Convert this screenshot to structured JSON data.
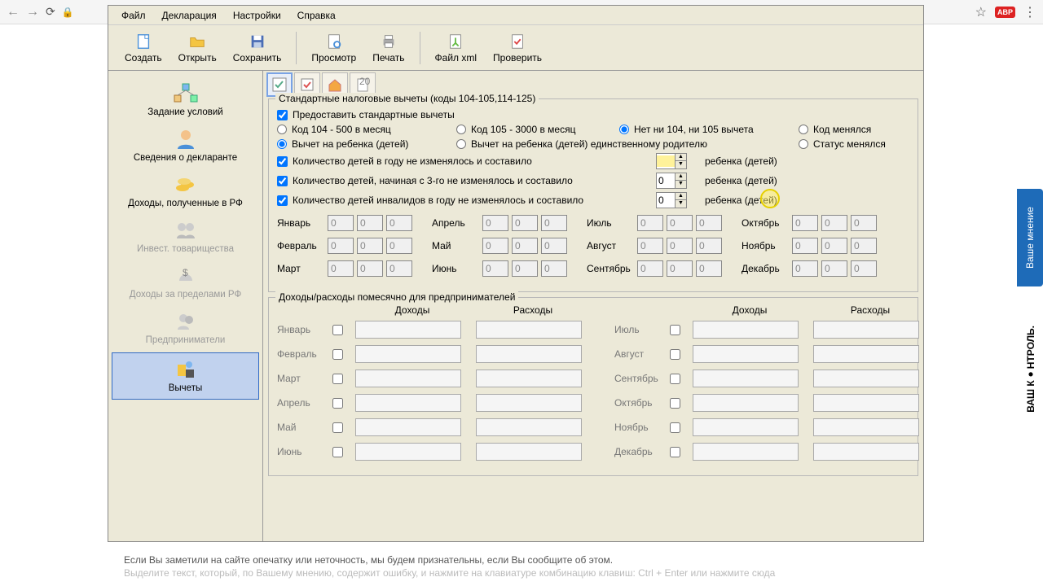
{
  "menu": [
    "Файл",
    "Декларация",
    "Настройки",
    "Справка"
  ],
  "toolbar": [
    "Создать",
    "Открыть",
    "Сохранить",
    "Просмотр",
    "Печать",
    "Файл xml",
    "Проверить"
  ],
  "sidebar": [
    {
      "label": "Задание условий",
      "disabled": false
    },
    {
      "label": "Сведения о декларанте",
      "disabled": false
    },
    {
      "label": "Доходы, полученные в РФ",
      "disabled": false
    },
    {
      "label": "Инвест. товарищества",
      "disabled": true
    },
    {
      "label": "Доходы за пределами РФ",
      "disabled": true
    },
    {
      "label": "Предприниматели",
      "disabled": true
    },
    {
      "label": "Вычеты",
      "disabled": false,
      "selected": true
    }
  ],
  "group1": {
    "title": "Стандартные налоговые вычеты (коды 104-105,114-125)",
    "provide": "Предоставить стандартные вычеты",
    "radios1": [
      "Код 104 - 500 в месяц",
      "Код 105 - 3000 в месяц",
      "Нет ни 104, ни 105 вычета",
      "Код менялся"
    ],
    "radios1_sel": 2,
    "radios2": [
      "Вычет на ребенка (детей)",
      "Вычет на ребенка (детей) единственному родителю",
      "Статус менялся"
    ],
    "radios2_sel": 0,
    "children_lines": [
      "Количество детей в году не изменялось и составило",
      "Количество детей, начиная с 3-го не изменялось и составило",
      "Количество детей инвалидов в году не изменялось и составило"
    ],
    "children_suffix": "ребенка (детей)",
    "children_values": [
      "",
      "0",
      "0"
    ],
    "months": [
      "Январь",
      "Февраль",
      "Март",
      "Апрель",
      "Май",
      "Июнь",
      "Июль",
      "Август",
      "Сентябрь",
      "Октябрь",
      "Ноябрь",
      "Декабрь"
    ],
    "month_val": "0"
  },
  "group2": {
    "title": "Доходы/расходы помесячно для предпринимателей",
    "income": "Доходы",
    "expense": "Расходы",
    "months_left": [
      "Январь",
      "Февраль",
      "Март",
      "Апрель",
      "Май",
      "Июнь"
    ],
    "months_right": [
      "Июль",
      "Август",
      "Сентябрь",
      "Октябрь",
      "Ноябрь",
      "Декабрь"
    ]
  },
  "footer": {
    "line1": "Если Вы заметили на сайте опечатку или неточность, мы будем признательны, если Вы сообщите об этом.",
    "line2": "Выделите текст, который, по Вашему мнению, содержит ошибку, и нажмите на клавиатуре комбинацию клавиш: Ctrl + Enter или нажмите сюда"
  },
  "side_tab": "Ваше мнение",
  "side_control": "ВАШ К●НТРОЛЬ."
}
